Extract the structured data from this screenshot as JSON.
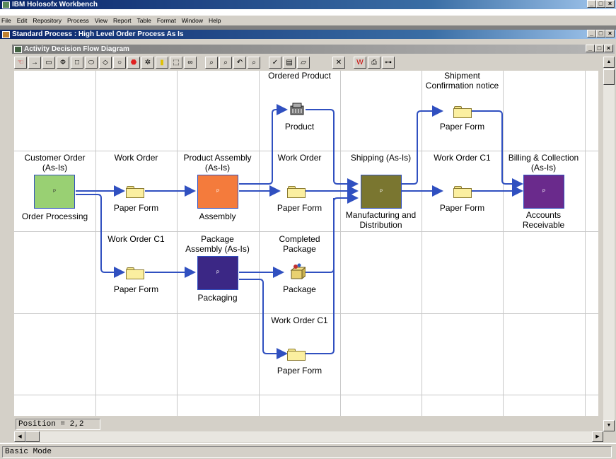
{
  "app": {
    "title": "IBM Holosofx Workbench"
  },
  "menu": [
    "File",
    "Edit",
    "Repository",
    "Process",
    "View",
    "Report",
    "Table",
    "Format",
    "Window",
    "Help"
  ],
  "doc_window": {
    "title": "Standard Process : High Level Order Process As Is"
  },
  "diagram_window": {
    "title": "Activity Decision Flow Diagram"
  },
  "toolbar": {
    "icons": [
      "select-icon",
      "arrow-icon",
      "rectangle-icon",
      "phi-icon",
      "square-icon",
      "oval-icon",
      "diamond-icon",
      "circle-icon",
      "stop-icon",
      "gear-icon",
      "note-icon",
      "dotted-box-icon",
      "link-icon",
      "zoom-in-icon",
      "zoom-out-icon",
      "undo-icon",
      "search-icon",
      "check-icon",
      "ruler-icon",
      "folder-icon",
      "fit-icon",
      "export-icon",
      "print-icon",
      "binoculars-icon"
    ]
  },
  "diagram": {
    "activities": [
      {
        "id": "order_processing",
        "heading": "Customer Order\n(As-Is)",
        "name": "Order Processing",
        "color": "#99d073"
      },
      {
        "id": "assembly",
        "heading": "Product Assembly\n(As-Is)",
        "name": "Assembly",
        "color": "#f47b3c"
      },
      {
        "id": "packaging",
        "heading": "Package\nAssembly (As-Is)",
        "name": "Packaging",
        "color": "#3b2785"
      },
      {
        "id": "shipping",
        "heading": "Shipping (As-Is)",
        "name": "Manufacturing and\nDistribution",
        "color": "#7a7630"
      },
      {
        "id": "billing",
        "heading": "Billing & Collection\n(As-Is)",
        "name": "Accounts\nReceivable",
        "color": "#6a2a8c"
      }
    ],
    "items": [
      {
        "id": "pf1",
        "heading": "Work Order",
        "name": "Paper Form"
      },
      {
        "id": "pf2",
        "heading": "Work Order C1",
        "name": "Paper Form"
      },
      {
        "id": "product",
        "heading": "Ordered Product",
        "name": "Product"
      },
      {
        "id": "pf3",
        "heading": "Work Order",
        "name": "Paper Form"
      },
      {
        "id": "package",
        "heading": "Completed\nPackage",
        "name": "Package"
      },
      {
        "id": "pf4",
        "heading": "Work Order C1",
        "name": "Paper Form"
      },
      {
        "id": "pf5",
        "heading": "Shipment\nConfirmation notice",
        "name": "Paper Form"
      },
      {
        "id": "pf6",
        "heading": "Work Order C1",
        "name": "Paper Form"
      }
    ]
  },
  "position": "Position = 2,2",
  "status": "Basic Mode",
  "colors": {
    "connector": "#3050c0",
    "titlebar": "#0a246a",
    "window_bg": "#d4d0c8"
  }
}
